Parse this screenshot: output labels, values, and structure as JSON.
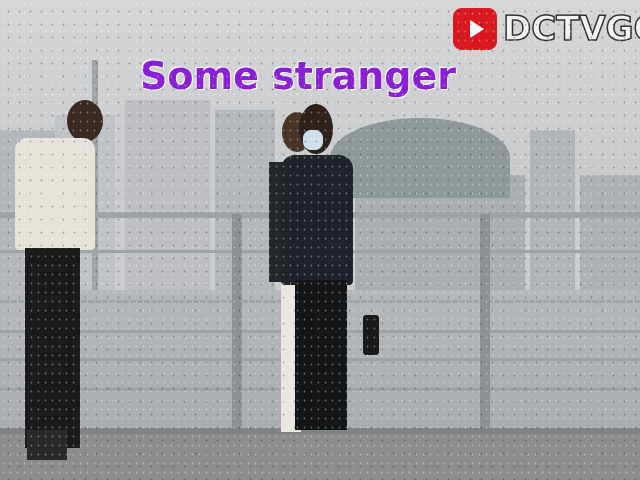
{
  "caption": "Some stranger",
  "watermark": {
    "brand": "DCTVGO",
    "icon": "youtube-play-icon",
    "icon_color": "#d9181f"
  },
  "scene": "riverside railing with city skyline"
}
